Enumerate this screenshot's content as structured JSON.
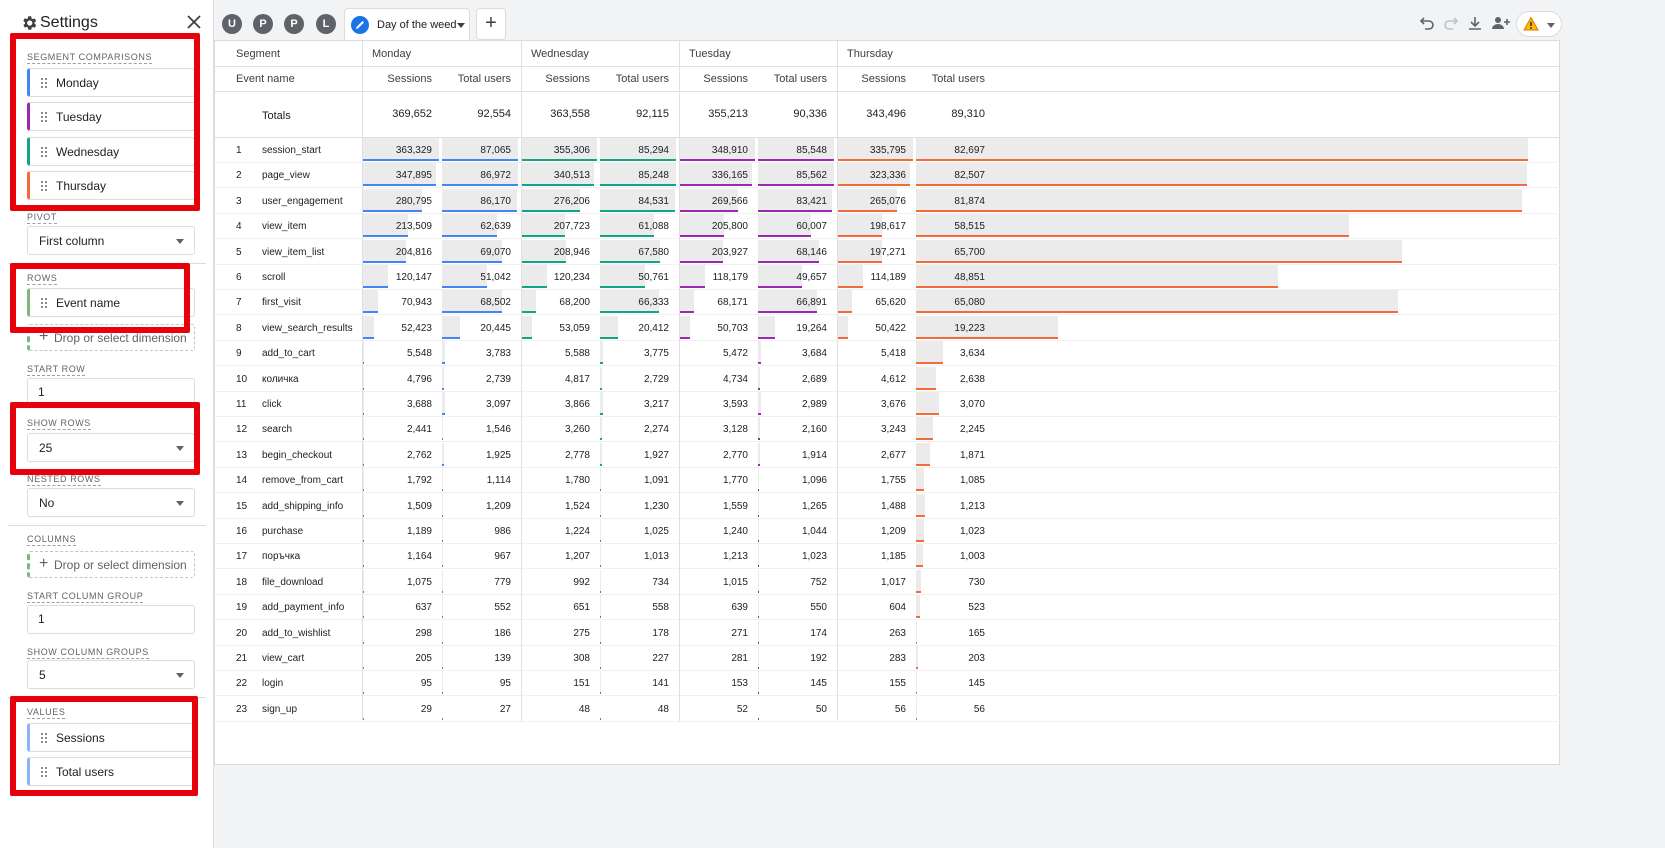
{
  "settings": {
    "title": "Settings",
    "segment_comparisons_label": "SEGMENT COMPARISONS",
    "segments": [
      {
        "label": "Monday",
        "color": "#4285f4"
      },
      {
        "label": "Tuesday",
        "color": "#9c27b0"
      },
      {
        "label": "Wednesday",
        "color": "#12a488"
      },
      {
        "label": "Thursday",
        "color": "#f26b3a"
      }
    ],
    "pivot_label": "PIVOT",
    "pivot_value": "First column",
    "rows_label": "ROWS",
    "row_dimension": "Event name",
    "drop_dimension_text": "Drop or select dimension",
    "start_row_label": "START ROW",
    "start_row_value": "1",
    "show_rows_label": "SHOW ROWS",
    "show_rows_value": "25",
    "nested_rows_label": "NESTED ROWS",
    "nested_rows_value": "No",
    "columns_label": "COLUMNS",
    "start_column_group_label": "START COLUMN GROUP",
    "start_column_group_value": "1",
    "show_column_groups_label": "SHOW COLUMN GROUPS",
    "show_column_groups_value": "5",
    "values_label": "VALUES",
    "values": [
      {
        "label": "Sessions",
        "color": "#8ab4f8"
      },
      {
        "label": "Total users",
        "color": "#8ab4f8"
      }
    ]
  },
  "tabs": {
    "avatars": [
      "U",
      "P",
      "P",
      "L"
    ],
    "active_label": "Day of the weed"
  },
  "table": {
    "segment_header": "Segment",
    "event_header": "Event name",
    "metric_headers": [
      "Sessions",
      "Total users"
    ],
    "groups": [
      {
        "name": "Monday",
        "color": "#4285f4"
      },
      {
        "name": "Wednesday",
        "color": "#12a488"
      },
      {
        "name": "Tuesday",
        "color": "#9c27b0"
      },
      {
        "name": "Thursday",
        "color": "#f26b3a"
      }
    ],
    "totals_label": "Totals",
    "totals": [
      "369,652",
      "92,554",
      "363,558",
      "92,115",
      "355,213",
      "90,336",
      "343,496",
      "89,310"
    ],
    "rows": [
      {
        "n": "1",
        "name": "session_start",
        "v": [
          "363,329",
          "87,065",
          "355,306",
          "85,294",
          "348,910",
          "85,548",
          "335,795",
          "82,697"
        ]
      },
      {
        "n": "2",
        "name": "page_view",
        "v": [
          "347,895",
          "86,972",
          "340,513",
          "85,248",
          "336,165",
          "85,562",
          "323,336",
          "82,507"
        ]
      },
      {
        "n": "3",
        "name": "user_engagement",
        "v": [
          "280,795",
          "86,170",
          "276,206",
          "84,531",
          "269,566",
          "83,421",
          "265,076",
          "81,874"
        ]
      },
      {
        "n": "4",
        "name": "view_item",
        "v": [
          "213,509",
          "62,639",
          "207,723",
          "61,088",
          "205,800",
          "60,007",
          "198,617",
          "58,515"
        ]
      },
      {
        "n": "5",
        "name": "view_item_list",
        "v": [
          "204,816",
          "69,070",
          "208,946",
          "67,580",
          "203,927",
          "68,146",
          "197,271",
          "65,700"
        ]
      },
      {
        "n": "6",
        "name": "scroll",
        "v": [
          "120,147",
          "51,042",
          "120,234",
          "50,761",
          "118,179",
          "49,657",
          "114,189",
          "48,851"
        ]
      },
      {
        "n": "7",
        "name": "first_visit",
        "v": [
          "70,943",
          "68,502",
          "68,200",
          "66,333",
          "68,171",
          "66,891",
          "65,620",
          "65,080"
        ]
      },
      {
        "n": "8",
        "name": "view_search_results",
        "v": [
          "52,423",
          "20,445",
          "53,059",
          "20,412",
          "50,703",
          "19,264",
          "50,422",
          "19,223"
        ]
      },
      {
        "n": "9",
        "name": "add_to_cart",
        "v": [
          "5,548",
          "3,783",
          "5,588",
          "3,775",
          "5,472",
          "3,684",
          "5,418",
          "3,634"
        ]
      },
      {
        "n": "10",
        "name": "количка",
        "v": [
          "4,796",
          "2,739",
          "4,817",
          "2,729",
          "4,734",
          "2,689",
          "4,612",
          "2,638"
        ]
      },
      {
        "n": "11",
        "name": "click",
        "v": [
          "3,688",
          "3,097",
          "3,866",
          "3,217",
          "3,593",
          "2,989",
          "3,676",
          "3,070"
        ]
      },
      {
        "n": "12",
        "name": "search",
        "v": [
          "2,441",
          "1,546",
          "3,260",
          "2,274",
          "3,128",
          "2,160",
          "3,243",
          "2,245"
        ]
      },
      {
        "n": "13",
        "name": "begin_checkout",
        "v": [
          "2,762",
          "1,925",
          "2,778",
          "1,927",
          "2,770",
          "1,914",
          "2,677",
          "1,871"
        ]
      },
      {
        "n": "14",
        "name": "remove_from_cart",
        "v": [
          "1,792",
          "1,114",
          "1,780",
          "1,091",
          "1,770",
          "1,096",
          "1,755",
          "1,085"
        ]
      },
      {
        "n": "15",
        "name": "add_shipping_info",
        "v": [
          "1,509",
          "1,209",
          "1,524",
          "1,230",
          "1,559",
          "1,265",
          "1,488",
          "1,213"
        ]
      },
      {
        "n": "16",
        "name": "purchase",
        "v": [
          "1,189",
          "986",
          "1,224",
          "1,025",
          "1,240",
          "1,044",
          "1,209",
          "1,023"
        ]
      },
      {
        "n": "17",
        "name": "поръчка",
        "v": [
          "1,164",
          "967",
          "1,207",
          "1,013",
          "1,213",
          "1,023",
          "1,185",
          "1,003"
        ]
      },
      {
        "n": "18",
        "name": "file_download",
        "v": [
          "1,075",
          "779",
          "992",
          "734",
          "1,015",
          "752",
          "1,017",
          "730"
        ]
      },
      {
        "n": "19",
        "name": "add_payment_info",
        "v": [
          "637",
          "552",
          "651",
          "558",
          "639",
          "550",
          "604",
          "523"
        ]
      },
      {
        "n": "20",
        "name": "add_to_wishlist",
        "v": [
          "298",
          "186",
          "275",
          "178",
          "271",
          "174",
          "263",
          "165"
        ]
      },
      {
        "n": "21",
        "name": "view_cart",
        "v": [
          "205",
          "139",
          "308",
          "227",
          "281",
          "192",
          "283",
          "203"
        ]
      },
      {
        "n": "22",
        "name": "login",
        "v": [
          "95",
          "95",
          "151",
          "141",
          "153",
          "145",
          "155",
          "145"
        ]
      },
      {
        "n": "23",
        "name": "sign_up",
        "v": [
          "29",
          "27",
          "48",
          "48",
          "52",
          "50",
          "56",
          "56"
        ]
      }
    ]
  }
}
